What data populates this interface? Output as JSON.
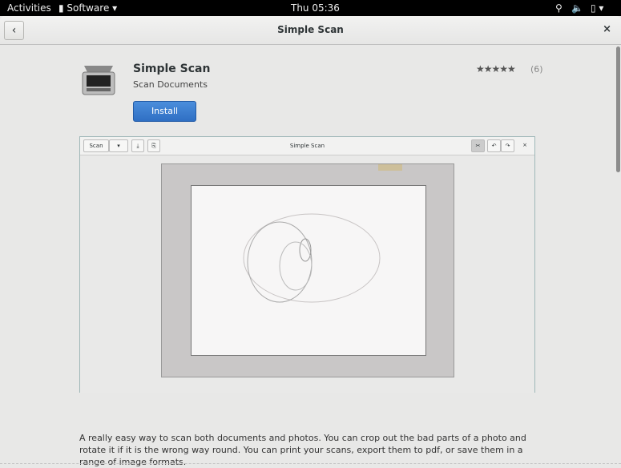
{
  "topbar": {
    "activities": "Activities",
    "app_menu": "Software",
    "clock": "Thu 05:36"
  },
  "header": {
    "title": "Simple Scan",
    "back": "‹",
    "close": "×"
  },
  "app": {
    "name": "Simple Scan",
    "summary": "Scan Documents",
    "install_label": "Install",
    "stars": "★★★★★",
    "rating_count": "(6)",
    "rating_value": 5,
    "description": "A really easy way to scan both documents and photos. You can crop out the bad parts of a photo and rotate it if it is the wrong way round. You can print your scans, export them to pdf, or save them in a range of image formats."
  },
  "screenshot": {
    "scan_label": "Scan",
    "dropdown": "▾",
    "save": "⤓",
    "page": "⎘",
    "title": "Simple Scan",
    "crop": "✂",
    "rotate_left": "↶",
    "rotate_right": "↷",
    "close": "×"
  }
}
